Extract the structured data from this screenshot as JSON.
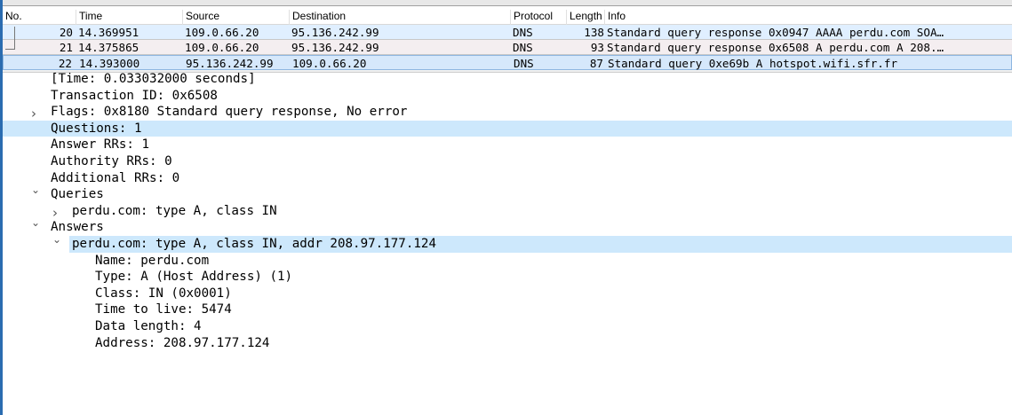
{
  "packet_list": {
    "columns": [
      "No.",
      "Time",
      "Source",
      "Destination",
      "Protocol",
      "Length",
      "Info"
    ],
    "rows": [
      {
        "no": "20",
        "time": "14.369951",
        "source": "109.0.66.20",
        "destination": "95.136.242.99",
        "protocol": "DNS",
        "length": "138",
        "info": "Standard query response 0x0947 AAAA perdu.com SOA…"
      },
      {
        "no": "21",
        "time": "14.375865",
        "source": "109.0.66.20",
        "destination": "95.136.242.99",
        "protocol": "DNS",
        "length": "93",
        "info": "Standard query response 0x6508 A perdu.com A 208.…"
      },
      {
        "no": "22",
        "time": "14.393000",
        "source": "95.136.242.99",
        "destination": "109.0.66.20",
        "protocol": "DNS",
        "length": "87",
        "info": "Standard query 0xe69b A hotspot.wifi.sfr.fr"
      }
    ]
  },
  "details": [
    {
      "text": "[Time: 0.033032000 seconds]",
      "level": 0,
      "expander": ""
    },
    {
      "text": "Transaction ID: 0x6508",
      "level": 0,
      "expander": ""
    },
    {
      "text": "Flags: 0x8180 Standard query response, No error",
      "level": 0,
      "expander": "collapsed"
    },
    {
      "text": "Questions: 1",
      "level": 0,
      "expander": "",
      "highlight": "full"
    },
    {
      "text": "Answer RRs: 1",
      "level": 0,
      "expander": ""
    },
    {
      "text": "Authority RRs: 0",
      "level": 0,
      "expander": ""
    },
    {
      "text": "Additional RRs: 0",
      "level": 0,
      "expander": ""
    },
    {
      "text": "Queries",
      "level": 0,
      "expander": "expanded"
    },
    {
      "text": "perdu.com: type A, class IN",
      "level": 1,
      "expander": "collapsed"
    },
    {
      "text": "Answers",
      "level": 0,
      "expander": "expanded"
    },
    {
      "text": "perdu.com: type A, class IN, addr 208.97.177.124",
      "level": 1,
      "expander": "expanded",
      "highlight": "item"
    },
    {
      "text": "Name: perdu.com",
      "level": 2,
      "expander": ""
    },
    {
      "text": "Type: A (Host Address) (1)",
      "level": 2,
      "expander": ""
    },
    {
      "text": "Class: IN (0x0001)",
      "level": 2,
      "expander": ""
    },
    {
      "text": "Time to live: 5474",
      "level": 2,
      "expander": ""
    },
    {
      "text": "Data length: 4",
      "level": 2,
      "expander": ""
    },
    {
      "text": "Address: 208.97.177.124",
      "level": 2,
      "expander": ""
    }
  ],
  "colors": {
    "selected_row": "#d6e8fb",
    "highlight": "#cde8fc",
    "frame": "#2b6cb0"
  }
}
